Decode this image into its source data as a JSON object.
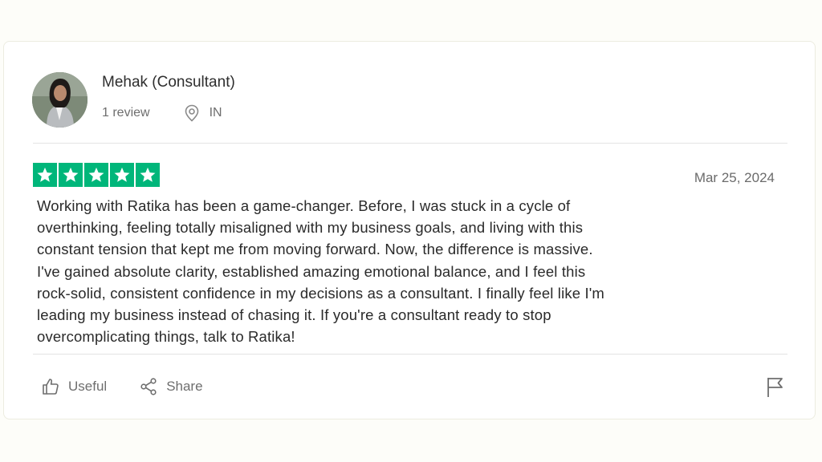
{
  "reviewer": {
    "name": "Mehak (Consultant)",
    "review_count": "1 review",
    "country": "IN",
    "avatar_icon": "person-photo"
  },
  "review": {
    "rating": 5,
    "max_rating": 5,
    "star_color": "#00b67a",
    "date": "Mar 25, 2024",
    "lines": [
      "Working with Ratika has been a game-changer. Before, I was stuck in a cycle of",
      "overthinking, feeling totally misaligned with my business goals, and living with this",
      "constant tension that kept me from moving forward. Now, the difference is massive.",
      "I've gained absolute clarity, established amazing emotional balance, and I feel this",
      "rock-solid, consistent confidence in my decisions as a consultant. I finally feel like I'm",
      "leading my business instead of chasing it. If you're a consultant ready to stop",
      "overcomplicating things, talk to Ratika!"
    ]
  },
  "actions": {
    "useful_label": "Useful",
    "share_label": "Share",
    "useful_icon": "thumbs-up-icon",
    "share_icon": "share-icon",
    "report_icon": "flag-icon"
  }
}
